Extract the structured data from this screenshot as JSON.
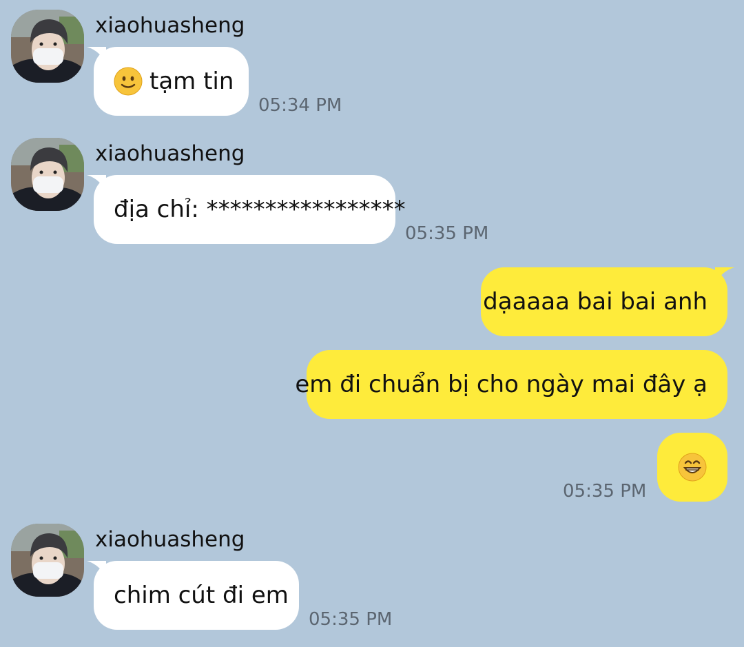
{
  "conversation": {
    "messages": [
      {
        "direction": "incoming",
        "sender": "xiaohuasheng",
        "emoji": "slightly-smiling-face-icon",
        "text": "tạm tin",
        "time": "05:34 PM"
      },
      {
        "direction": "incoming",
        "sender": "xiaohuasheng",
        "text": "địa chỉ: *****************",
        "time": "05:35 PM"
      },
      {
        "direction": "outgoing",
        "text": "dạaaaa bai bai anh"
      },
      {
        "direction": "outgoing",
        "text": "em đi chuẩn bị cho ngày mai đây ạ"
      },
      {
        "direction": "outgoing",
        "emoji": "grinning-face-icon",
        "time": "05:35 PM"
      },
      {
        "direction": "incoming",
        "sender": "xiaohuasheng",
        "text": "chim cút đi em",
        "time": "05:35 PM"
      }
    ]
  },
  "colors": {
    "background": "#b2c7da",
    "incoming_bubble": "#ffffff",
    "outgoing_bubble": "#feeb3b",
    "timestamp": "#5b6570"
  }
}
